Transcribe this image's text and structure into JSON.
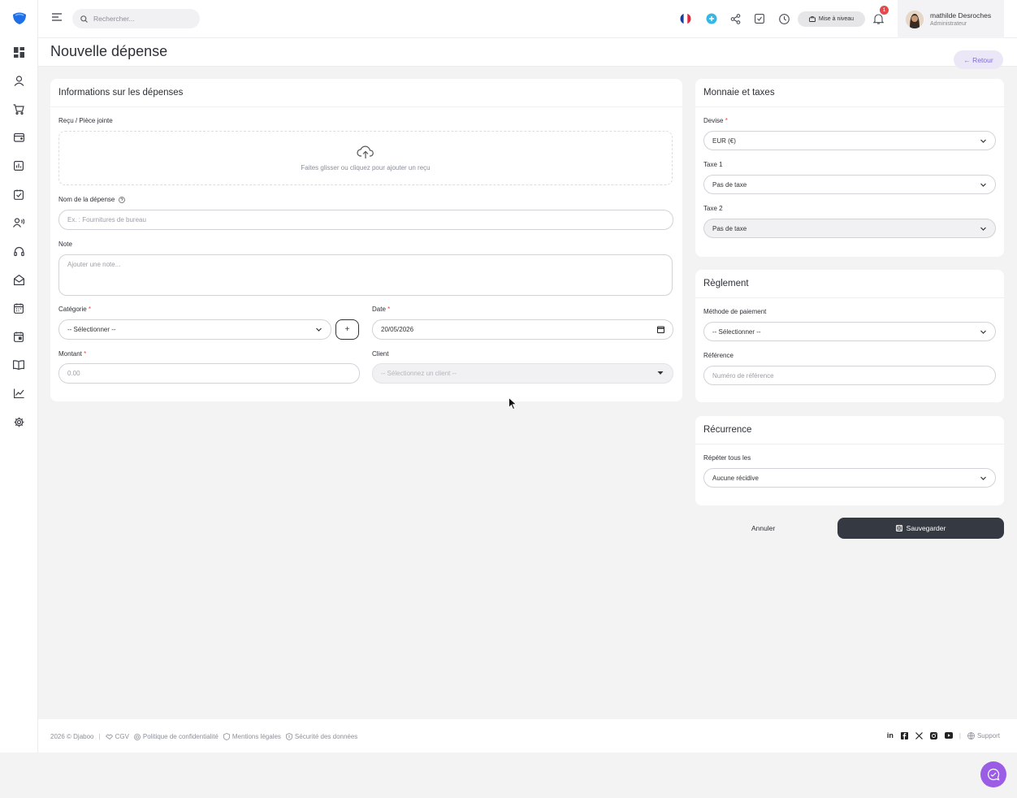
{
  "search": {
    "placeholder": "Rechercher..."
  },
  "topbar": {
    "upgrade_label": "Mise à niveau",
    "notifications_count": "1"
  },
  "user": {
    "name": "mathilde Desroches",
    "role": "Administrateur"
  },
  "page": {
    "title": "Nouvelle dépense",
    "back_label": "← Retour"
  },
  "expense_card": {
    "title": "Informations sur les dépenses",
    "receipt_label": "Reçu / Pièce jointe",
    "dropzone_text": "Faites glisser ou cliquez pour ajouter un reçu",
    "name_label": "Nom de la dépense",
    "name_placeholder": "Ex. : Fournitures de bureau",
    "note_label": "Note",
    "note_placeholder": "Ajouter une note...",
    "category_label": "Catégorie",
    "category_value": "-- Sélectionner --",
    "add_category": "+",
    "date_label": "Date",
    "date_value": "20/05/2026",
    "amount_label": "Montant",
    "amount_placeholder": "0.00",
    "client_label": "Client",
    "client_placeholder": "-- Sélectionnez un client --",
    "required_mark": "*"
  },
  "currency_card": {
    "title": "Monnaie et taxes",
    "currency_label": "Devise",
    "currency_value": "EUR (€)",
    "tax1_label": "Taxe 1",
    "tax1_value": "Pas de taxe",
    "tax2_label": "Taxe 2",
    "tax2_value": "Pas de taxe"
  },
  "payment_card": {
    "title": "Règlement",
    "method_label": "Méthode de paiement",
    "method_value": "-- Sélectionner --",
    "reference_label": "Référence",
    "reference_placeholder": "Numéro de référence"
  },
  "recurrence_card": {
    "title": "Récurrence",
    "repeat_label": "Répéter tous les",
    "repeat_value": "Aucune récidive"
  },
  "actions": {
    "cancel": "Annuler",
    "save": "Sauvegarder"
  },
  "footer": {
    "copyright": "2026 © Djaboo",
    "cgv": "CGV",
    "privacy": "Politique de confidentialité",
    "legal": "Mentions légales",
    "security": "Sécurité des données",
    "support": "Support"
  },
  "colors": {
    "accent": "#7f6bd4",
    "dark_button": "#353941",
    "chat": "#9b5de5",
    "required": "#e5484d"
  }
}
